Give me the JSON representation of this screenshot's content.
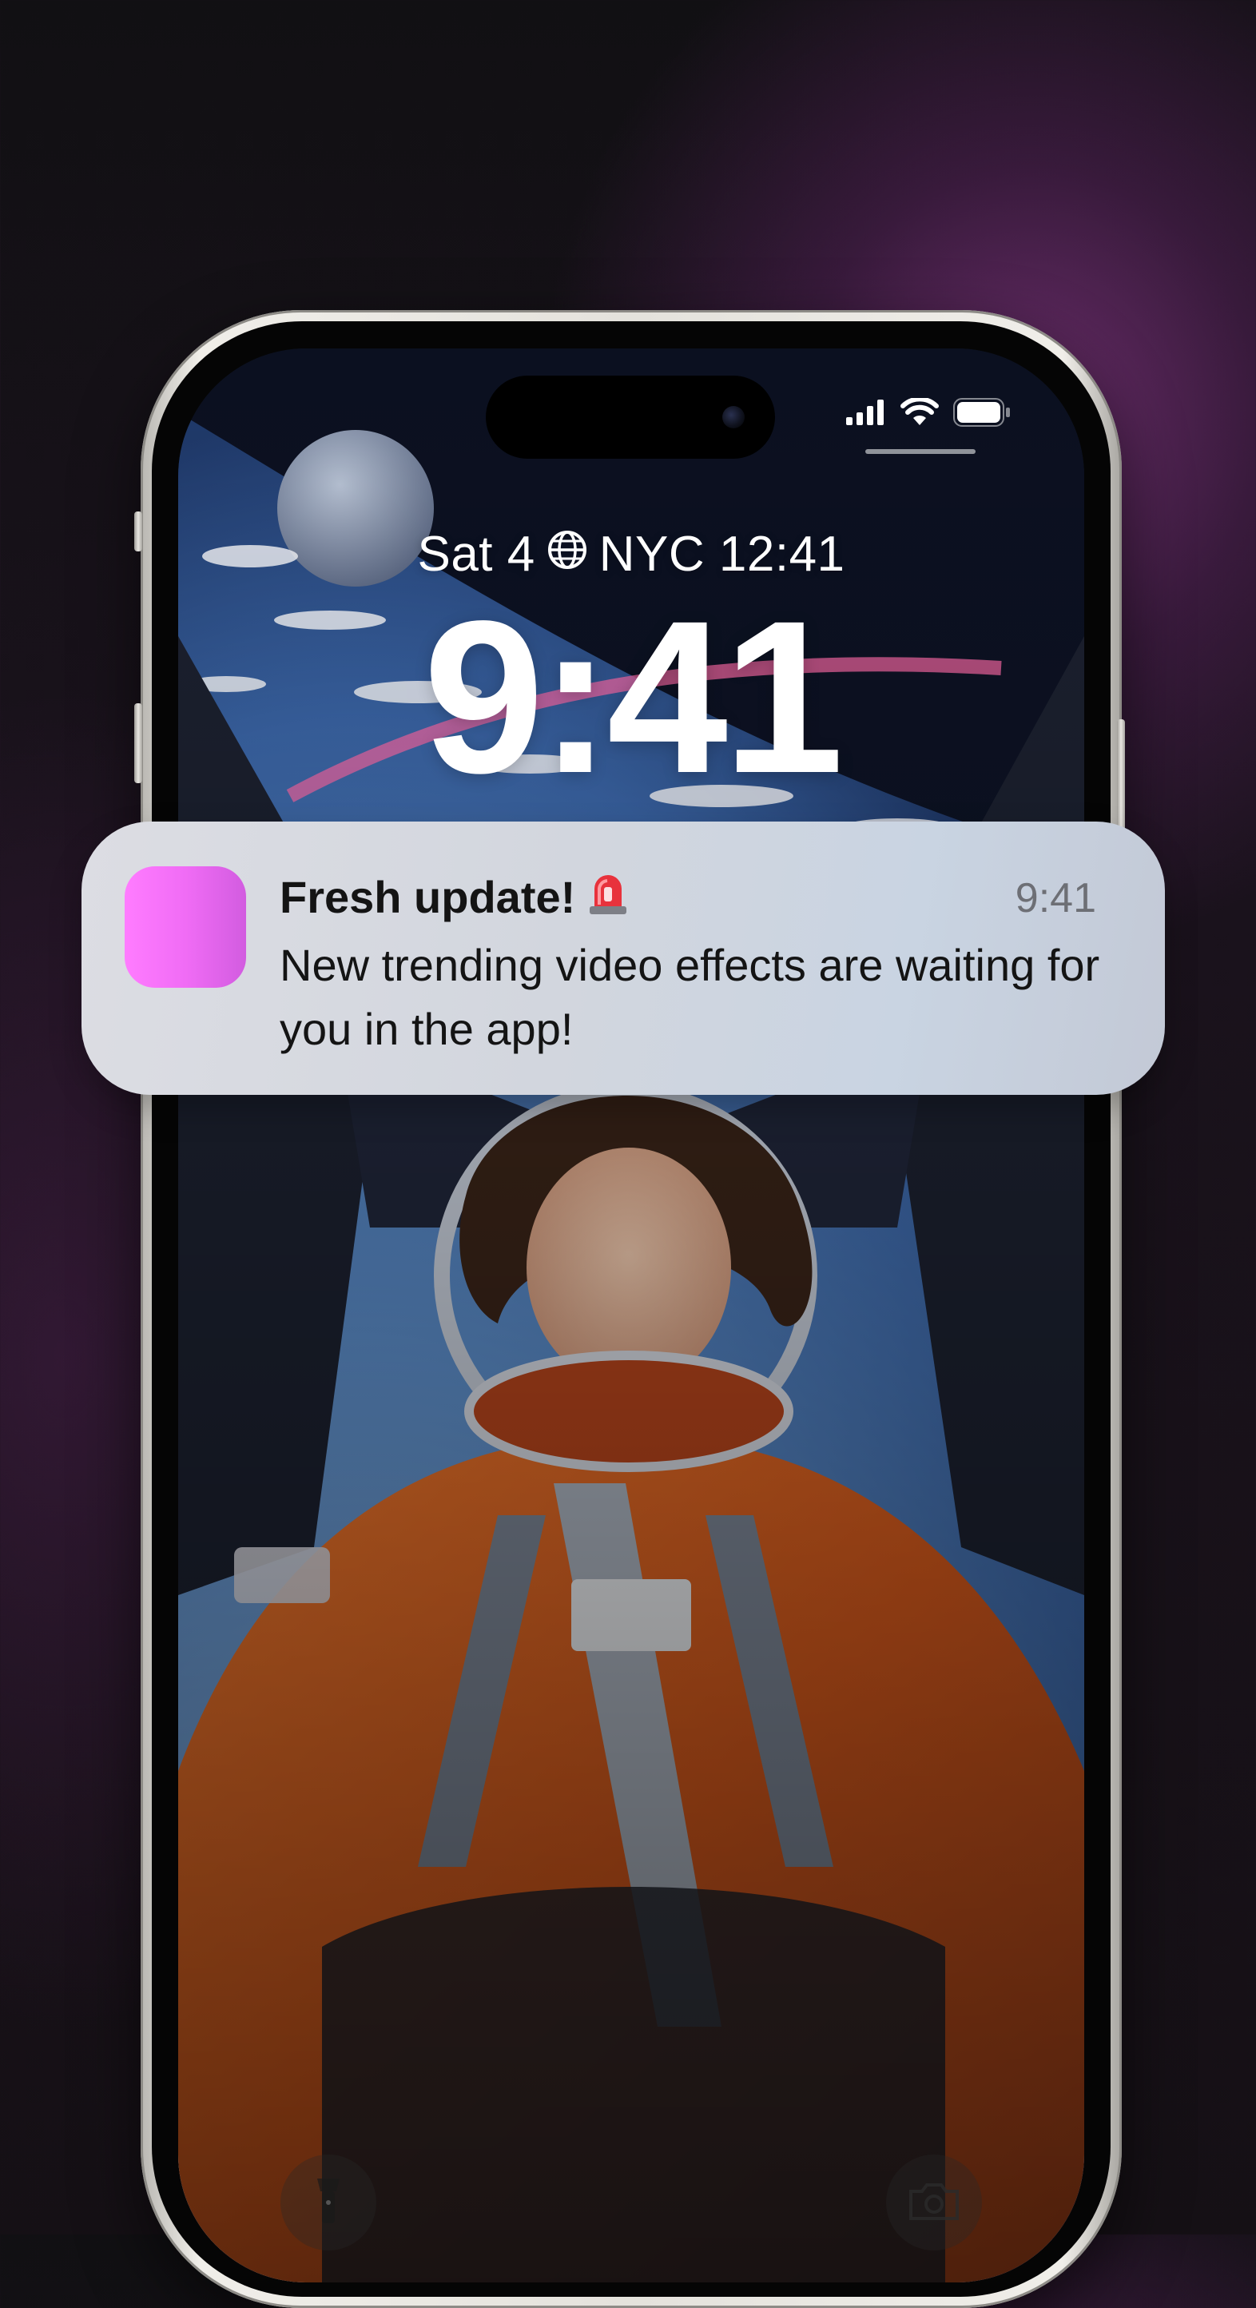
{
  "status_bar": {
    "signal": "cellular-signal-icon",
    "wifi": "wifi-icon",
    "battery": "battery-icon"
  },
  "lock_screen": {
    "date_prefix": "Sat 4",
    "world_clock_icon": "globe-icon",
    "world_clock": "NYC 12:41",
    "time": "9:41"
  },
  "notification": {
    "title": "Fresh update!",
    "title_emoji": "🚨",
    "time": "9:41",
    "body": "New trending video effects are waiting for you in the app!",
    "app_icon_color": "#f56ef8"
  },
  "quick_actions": {
    "left": "flashlight-icon",
    "right": "camera-icon"
  },
  "colors": {
    "background": "#141015",
    "glow": "#6e2f6e",
    "phone_frame": "#eceae5"
  }
}
